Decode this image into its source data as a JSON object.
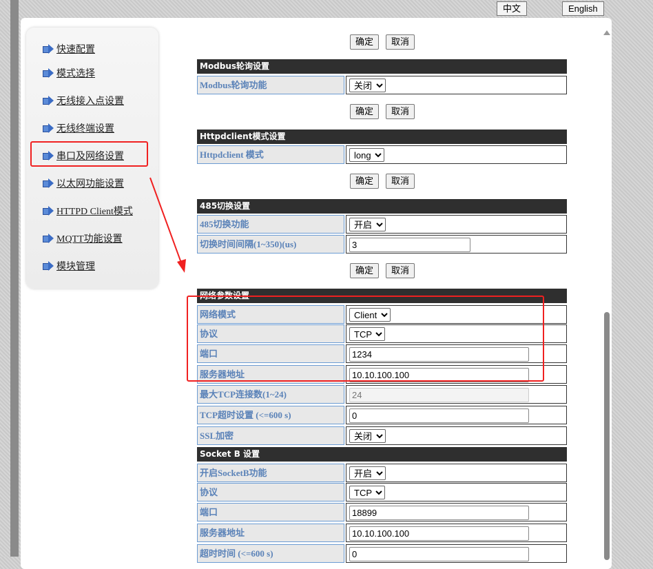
{
  "lang": {
    "zh": "中文",
    "en": "English"
  },
  "nav": [
    "快速配置",
    "模式选择",
    "无线接入点设置",
    "无线终端设置",
    "串口及网络设置",
    "以太网功能设置",
    "HTTPD Client模式",
    "MQTT功能设置",
    "模块管理"
  ],
  "buttons": {
    "ok": "确定",
    "cancel": "取消"
  },
  "modbus": {
    "title": "Modbus轮询设置",
    "label": "Modbus轮询功能",
    "value": "关闭"
  },
  "httpd": {
    "title": "Httpdclient模式设置",
    "label": "Httpdclient 模式",
    "value": "long"
  },
  "rs485": {
    "title": "485切换设置",
    "label1": "485切换功能",
    "value1": "开启",
    "label2": "切换时间间隔(1~350)(us)",
    "value2": "3"
  },
  "net": {
    "title": "网络参数设置",
    "mode_label": "网络模式",
    "mode": "Client",
    "proto_label": "协议",
    "proto": "TCP",
    "port_label": "端口",
    "port": "1234",
    "server_label": "服务器地址",
    "server": "10.10.100.100",
    "maxtcp_label": "最大TCP连接数(1~24)",
    "maxtcp": "24",
    "timeout_label": "TCP超时设置 (<=600 s)",
    "timeout": "0",
    "ssl_label": "SSL加密",
    "ssl": "关闭"
  },
  "socketb": {
    "title": "Socket B 设置",
    "enable_label": "开启SocketB功能",
    "enable": "开启",
    "proto_label": "协议",
    "proto": "TCP",
    "port_label": "端口",
    "port": "18899",
    "server_label": "服务器地址",
    "server": "10.10.100.100",
    "timeout_label": "超时时间 (<=600 s)",
    "timeout": "0"
  }
}
